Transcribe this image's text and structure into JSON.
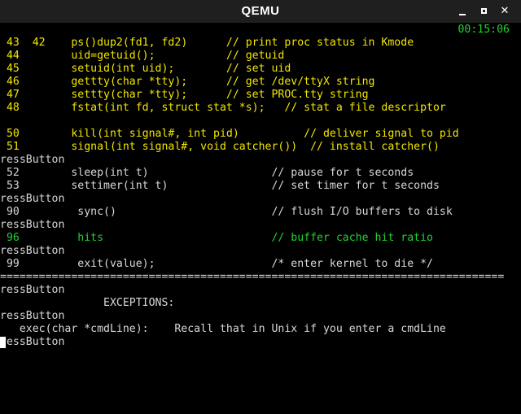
{
  "window": {
    "title": "QEMU",
    "controls": {
      "minimize_icon": "minimize-icon",
      "maximize_icon": "maximize-icon",
      "close_glyph": "✕"
    }
  },
  "terminal": {
    "clock": "00:15:06",
    "colors": {
      "yellow": "#f2e600",
      "green": "#22d22f",
      "white": "#d8d8d8",
      "background": "#000000"
    },
    "lines": [
      " 42        dup2(fd1, fd2)",
      " 43        ps()                    // print proc status in Kmode",
      " 44        uid=getuid();           // getuid",
      " 45        setuid(int uid);        // set uid",
      " 46        gettty(char *tty);      // get /dev/ttyX string",
      " 47        settty(char *tty);      // set PROC.tty string",
      " 48        fstat(int fd, struct stat *s);   // stat a file descriptor",
      "",
      " 50        kill(int signal#, int pid)          // deliver signal to pid",
      " 51        signal(int signal#, void catcher())  // install catcher()",
      "ressButton",
      " 52        sleep(int t)                   // pause for t seconds",
      " 53        settimer(int t)                // set timer for t seconds",
      "ressButton",
      " 90         sync()                        // flush I/O buffers to disk",
      "ressButton",
      " 96         hits                          // buffer cache hit ratio",
      "ressButton",
      " 99         exit(value);                  /* enter kernel to die */",
      "==============================================================================",
      "ressButton",
      "                EXCEPTIONS:",
      "ressButton",
      "   exec(char *cmdLine):    Recall that in Unix if you enter a cmdLine",
      "ressButton"
    ]
  }
}
